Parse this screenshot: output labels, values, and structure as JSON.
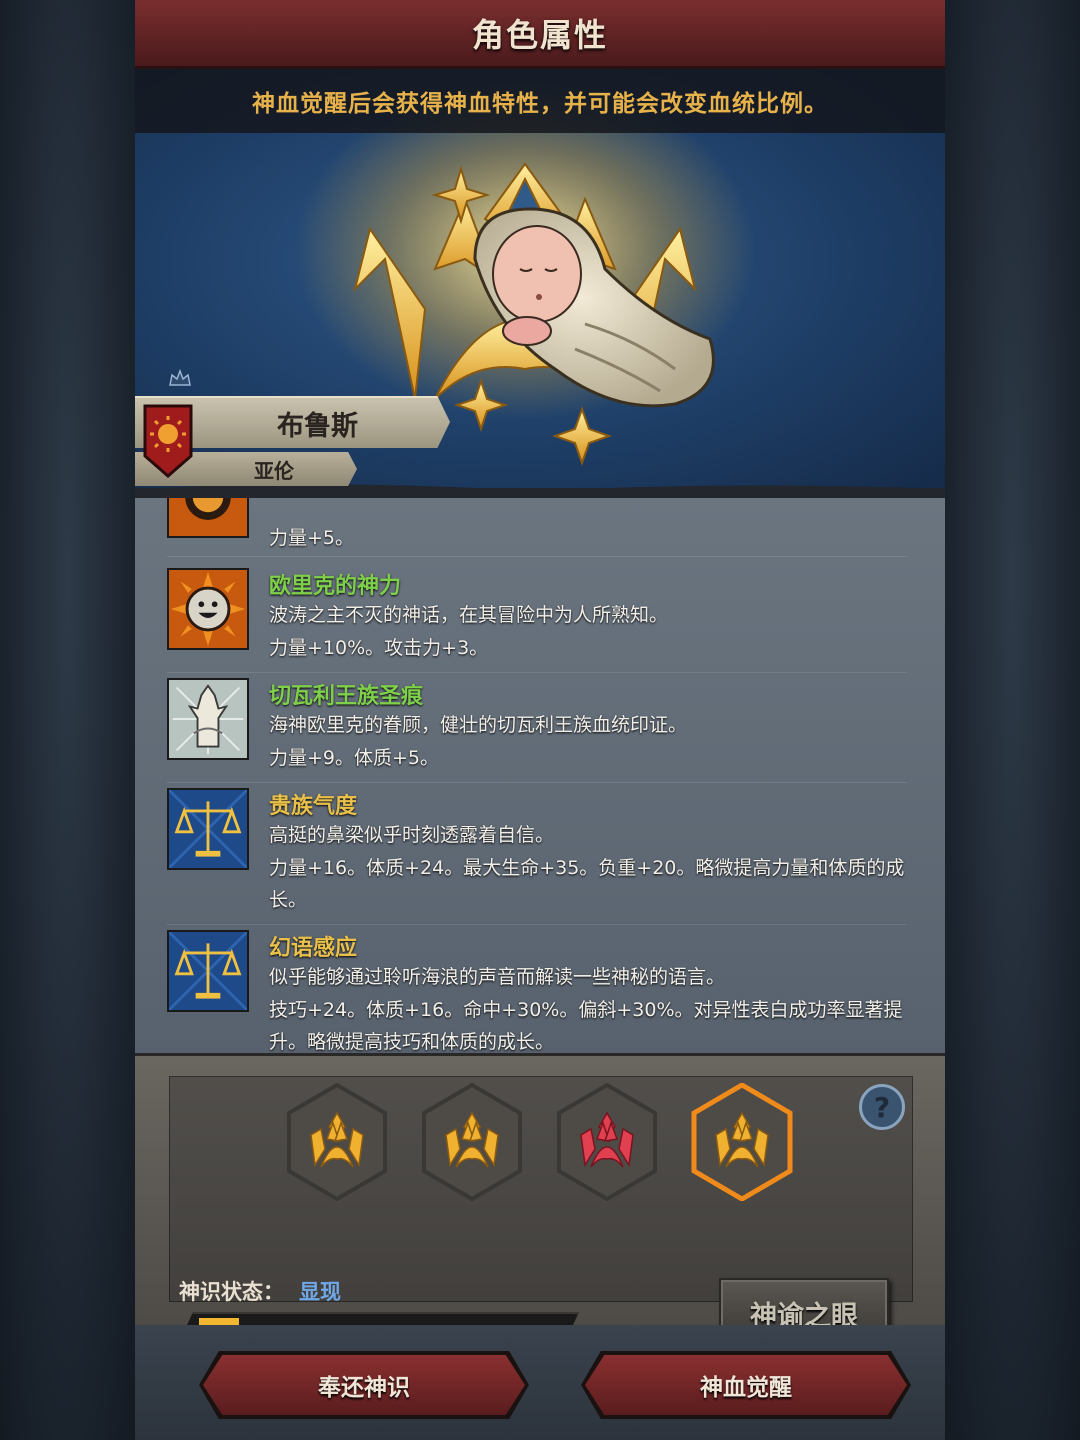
{
  "header": {
    "title": "角色属性",
    "hint": "神血觉醒后会获得神血特性，并可能会改变血统比例。"
  },
  "character": {
    "name": "布鲁斯",
    "house": "亚伦"
  },
  "traits": [
    {
      "name": "",
      "desc": "",
      "effect": "力量+5。",
      "icon": "sun-eye-icon",
      "name_color": "#7ed04a"
    },
    {
      "name": "欧里克的神力",
      "desc": "波涛之主不灭的神话，在其冒险中为人所熟知。",
      "effect": "力量+10%。攻击力+3。",
      "icon": "smiling-sun-icon",
      "name_color": "#7ed04a"
    },
    {
      "name": "切瓦利王族圣痕",
      "desc": "海神欧里克的眷顾，健壮的切瓦利王族血统印证。",
      "effect": "力量+9。体质+5。",
      "icon": "trident-emblem-icon",
      "name_color": "#7ed04a"
    },
    {
      "name": "贵族气度",
      "desc": "高挺的鼻梁似乎时刻透露着自信。",
      "effect": "力量+16。体质+24。最大生命+35。负重+20。略微提高力量和体质的成长。",
      "icon": "scales-icon",
      "name_color": "#e8c04a"
    },
    {
      "name": "幻语感应",
      "desc": "似乎能够通过聆听海浪的声音而解读一些神秘的语言。",
      "effect": "技巧+24。体质+16。命中+30%。偏斜+30%。对异性表白成功率显著提升。略微提高技巧和体质的成长。",
      "icon": "scales-icon",
      "name_color": "#e8c04a"
    }
  ],
  "divine_slots": [
    {
      "icon": "divine-crest-gold-icon",
      "color": "#f0b030",
      "selected": false
    },
    {
      "icon": "divine-crest-gold-icon",
      "color": "#f0b030",
      "selected": false
    },
    {
      "icon": "divine-crest-red-icon",
      "color": "#e04050",
      "selected": false
    },
    {
      "icon": "divine-crest-gold-icon",
      "color": "#f0b030",
      "selected": true
    }
  ],
  "status": {
    "label": "神识状态：",
    "value": "显现",
    "progress": 0.11
  },
  "buttons": {
    "oracle": "神谕之眼",
    "return": "奉还神识",
    "awaken": "神血觉醒",
    "help": "?"
  },
  "colors": {
    "accent_gold": "#e8b24a",
    "status_blue": "#6fa8e8",
    "button_red": "#8a3030"
  }
}
